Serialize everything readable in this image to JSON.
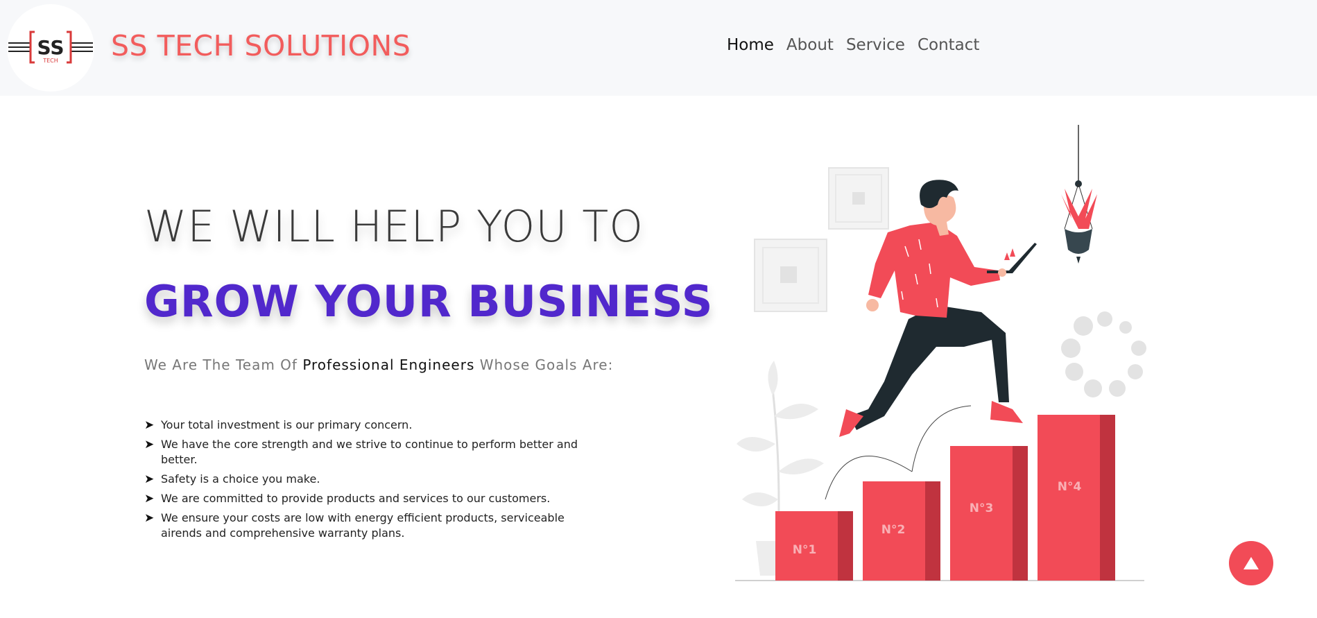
{
  "header": {
    "logo_text": "SS",
    "logo_subtext": "TECH",
    "brand": "SS TECH SOLUTIONS",
    "nav": [
      {
        "label": "Home",
        "active": true
      },
      {
        "label": "About",
        "active": false
      },
      {
        "label": "Service",
        "active": false
      },
      {
        "label": "Contact",
        "active": false
      }
    ]
  },
  "hero": {
    "line1": "WE WILL HELP YOU TO",
    "line2": "GROW YOUR BUSINESS",
    "team_prefix": "We Are The Team Of",
    "team_highlight": "Professional Engineers",
    "team_suffix": "Whose Goals Are:",
    "bullet_symbol": "➤",
    "goals": [
      "Your total investment is our primary concern.",
      "We have the core strength and we strive to continue to perform better and better.",
      "Safety is a choice you make.",
      "We are committed to provide products and services to our customers.",
      "We ensure your costs are low with energy efficient products, serviceable airends and comprehensive warranty plans."
    ]
  },
  "illustration": {
    "steps": [
      "N°1",
      "N°2",
      "N°3",
      "N°4"
    ]
  },
  "colors": {
    "brand_red": "#f25c5c",
    "hero_purple": "#5128cc",
    "step_red": "#f24b57",
    "step_dark": "#c0333f",
    "nav_bg": "#f7f8fa"
  },
  "icons": {
    "scroll_top": "triangle-up-icon"
  }
}
